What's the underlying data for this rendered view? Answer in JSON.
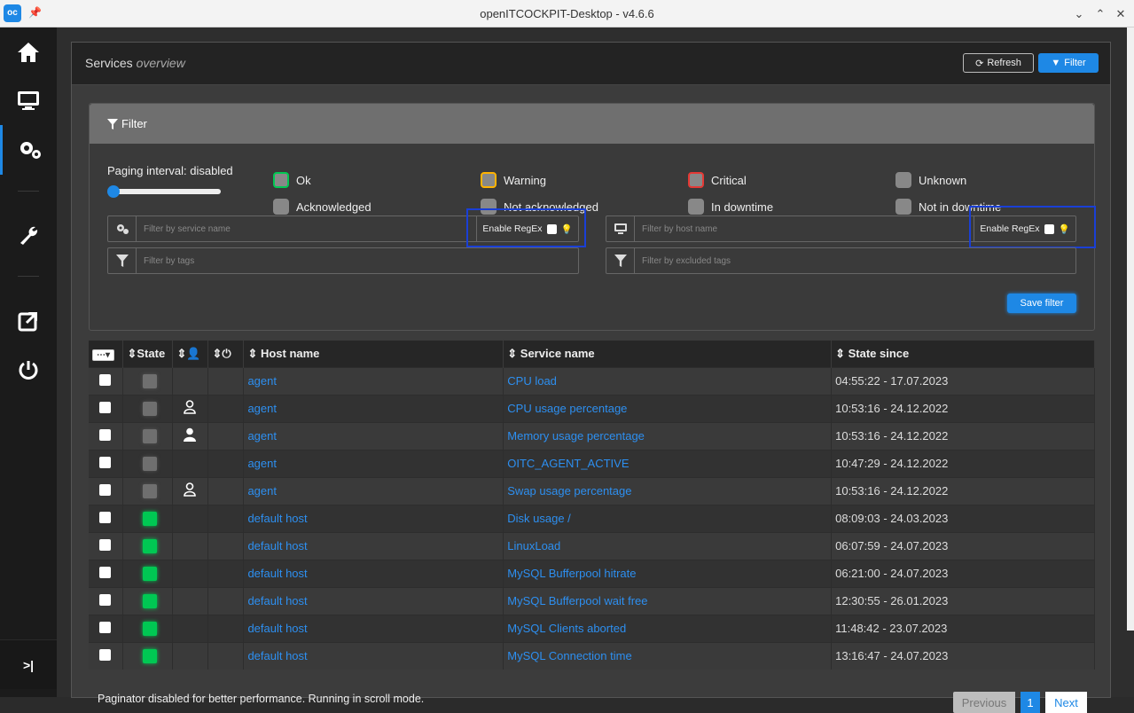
{
  "window": {
    "title": "openITCOCKPIT-Desktop - v4.6.6",
    "app_icon": "oc"
  },
  "header": {
    "title": "Services",
    "subtitle": "overview",
    "refresh_label": "Refresh",
    "filter_label": "Filter"
  },
  "filter": {
    "title": "Filter",
    "paging_label": "Paging interval: disabled",
    "paging_value": 0,
    "states": [
      {
        "label": "Ok",
        "border": "#00c853"
      },
      {
        "label": "Warning",
        "border": "#ffb300"
      },
      {
        "label": "Critical",
        "border": "#e53935"
      },
      {
        "label": "Unknown",
        "border": "#888888"
      },
      {
        "label": "Acknowledged",
        "border": "#888888"
      },
      {
        "label": "Not acknowledged",
        "border": "#888888"
      },
      {
        "label": "In downtime",
        "border": "#888888"
      },
      {
        "label": "Not in downtime",
        "border": "#888888"
      }
    ],
    "service_placeholder": "Filter by service name",
    "host_placeholder": "Filter by host name",
    "tags_placeholder": "Filter by tags",
    "excluded_tags_placeholder": "Filter by excluded tags",
    "regex_label": "Enable RegEx",
    "save_label": "Save filter"
  },
  "table": {
    "headers": {
      "state": "State",
      "host": "Host name",
      "service": "Service name",
      "since": "State since"
    },
    "rows": [
      {
        "state": "unknown",
        "ack": "",
        "host": "agent",
        "service": "CPU load",
        "since": "04:55:22 - 17.07.2023"
      },
      {
        "state": "unknown",
        "ack": "outline",
        "host": "agent",
        "service": "CPU usage percentage",
        "since": "10:53:16 - 24.12.2022"
      },
      {
        "state": "unknown",
        "ack": "solid",
        "host": "agent",
        "service": "Memory usage percentage",
        "since": "10:53:16 - 24.12.2022"
      },
      {
        "state": "unknown",
        "ack": "",
        "host": "agent",
        "service": "OITC_AGENT_ACTIVE",
        "since": "10:47:29 - 24.12.2022"
      },
      {
        "state": "unknown",
        "ack": "outline",
        "host": "agent",
        "service": "Swap usage percentage",
        "since": "10:53:16 - 24.12.2022"
      },
      {
        "state": "ok",
        "ack": "",
        "host": "default host",
        "service": "Disk usage /",
        "since": "08:09:03 - 24.03.2023"
      },
      {
        "state": "ok",
        "ack": "",
        "host": "default host",
        "service": "LinuxLoad",
        "since": "06:07:59 - 24.07.2023"
      },
      {
        "state": "ok",
        "ack": "",
        "host": "default host",
        "service": "MySQL Bufferpool hitrate",
        "since": "06:21:00 - 24.07.2023"
      },
      {
        "state": "ok",
        "ack": "",
        "host": "default host",
        "service": "MySQL Bufferpool wait free",
        "since": "12:30:55 - 26.01.2023"
      },
      {
        "state": "ok",
        "ack": "",
        "host": "default host",
        "service": "MySQL Clients aborted",
        "since": "11:48:42 - 23.07.2023"
      },
      {
        "state": "ok",
        "ack": "",
        "host": "default host",
        "service": "MySQL Connection time",
        "since": "13:16:47 - 24.07.2023"
      }
    ]
  },
  "footer": {
    "text": "Paginator disabled for better performance. Running in scroll mode.",
    "previous": "Previous",
    "page": "1",
    "next": "Next"
  },
  "colors": {
    "accent": "#1e88e5",
    "ok": "#00c853",
    "unknown": "#6f6f6f",
    "link": "#2d8ff0"
  }
}
